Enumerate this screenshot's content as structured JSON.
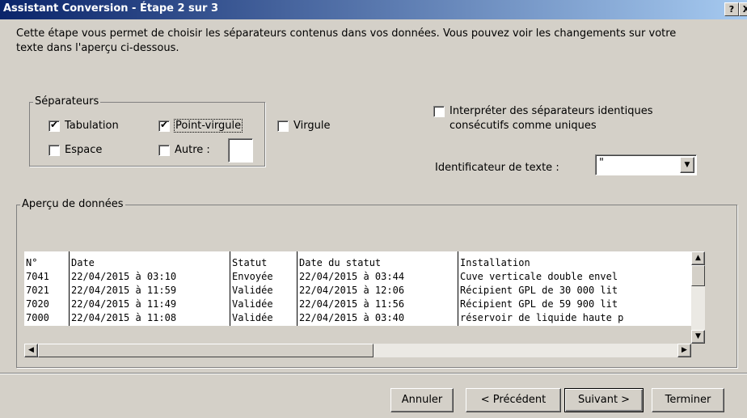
{
  "window": {
    "title": "Assistant Conversion - Étape 2 sur 3",
    "help": "?",
    "close": "X"
  },
  "description": "Cette étape vous permet de choisir les séparateurs contenus dans vos données. Vous pouvez voir les changements sur votre texte dans l'aperçu ci-dessous.",
  "separators": {
    "legend": "Séparateurs",
    "tab": {
      "label": "Tabulation",
      "checked": true
    },
    "semicolon": {
      "label": "Point-virgule",
      "checked": true
    },
    "comma": {
      "label": "Virgule",
      "checked": false
    },
    "space": {
      "label": "Espace",
      "checked": false
    },
    "other": {
      "label": "Autre :",
      "checked": false,
      "value": ""
    }
  },
  "consecutive": {
    "label": "Interpréter des séparateurs identiques consécutifs comme uniques",
    "checked": false
  },
  "text_qualifier": {
    "label": "Identificateur de texte :",
    "value": "\""
  },
  "preview": {
    "legend": "Aperçu de données",
    "columns": [
      {
        "header": "N°",
        "cells": [
          "7041",
          "7021",
          "7020",
          "7000"
        ]
      },
      {
        "header": "Date",
        "cells": [
          "22/04/2015 à 03:10",
          "22/04/2015 à 11:59",
          "22/04/2015 à 11:49",
          "22/04/2015 à 11:08"
        ]
      },
      {
        "header": "Statut",
        "cells": [
          "Envoyée",
          "Validée",
          "Validée",
          "Validée"
        ]
      },
      {
        "header": "Date du statut",
        "cells": [
          "22/04/2015 à 03:44",
          "22/04/2015 à 12:06",
          "22/04/2015 à 11:56",
          "22/04/2015 à 03:40"
        ]
      },
      {
        "header": "Installation",
        "cells": [
          "Cuve verticale double envel",
          "Récipient GPL de 30 000 lit",
          "Récipient GPL de 59 900 lit",
          "réservoir de liquide haute p"
        ]
      }
    ]
  },
  "buttons": {
    "cancel": "Annuler",
    "previous": "< Précédent",
    "next": "Suivant >",
    "finish": "Terminer"
  }
}
